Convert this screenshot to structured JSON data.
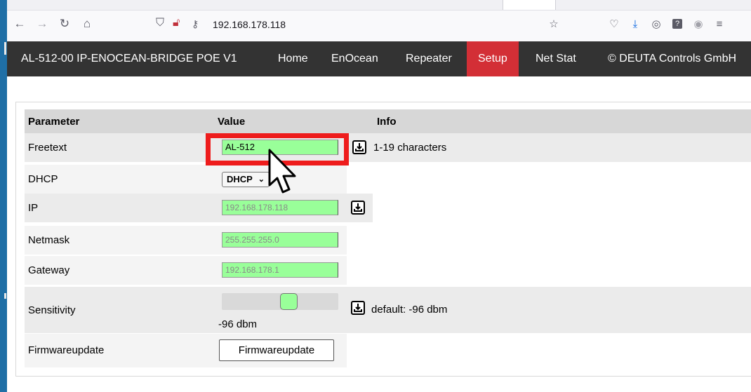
{
  "browser": {
    "url": "192.168.178.118",
    "icons": [
      "back-icon",
      "forward-icon",
      "reload-icon",
      "home-icon",
      "shield-icon",
      "lock-broken-icon",
      "key-icon",
      "bookmark-star-icon",
      "pocket-icon",
      "download-icon",
      "extension-icon",
      "help-icon",
      "account-icon",
      "menu-icon"
    ]
  },
  "navbar": {
    "brand": "AL-512-00 IP-ENOCEAN-BRIDGE POE V1",
    "items": [
      "Home",
      "EnOcean",
      "Repeater",
      "Setup",
      "Net Stat",
      "© DEUTA Controls GmbH"
    ],
    "active": "Setup"
  },
  "table": {
    "headers": {
      "parameter": "Parameter",
      "value": "Value",
      "info": "Info"
    },
    "freetext": {
      "label": "Freetext",
      "value": "AL-512",
      "info": "1-19 characters"
    },
    "dhcp": {
      "label": "DHCP",
      "value": "DHCP"
    },
    "ip": {
      "label": "IP",
      "value": "192.168.178.118"
    },
    "netmask": {
      "label": "Netmask",
      "value": "255.255.255.0"
    },
    "gateway": {
      "label": "Gateway",
      "value": "192.168.178.1"
    },
    "sensitivity": {
      "label": "Sensitivity",
      "value": "-96 dbm",
      "info": "default: -96 dbm",
      "slider_fraction": 0.5
    },
    "firmware": {
      "label": "Firmwareupdate",
      "button": "Firmwareupdate"
    }
  },
  "colors": {
    "navbar": "#333333",
    "active_tab": "#d32f36",
    "field": "#99ff99",
    "highlight": "#ee1c1c",
    "header_row": "#d7d7d7",
    "row_alt": "#ebebeb"
  }
}
